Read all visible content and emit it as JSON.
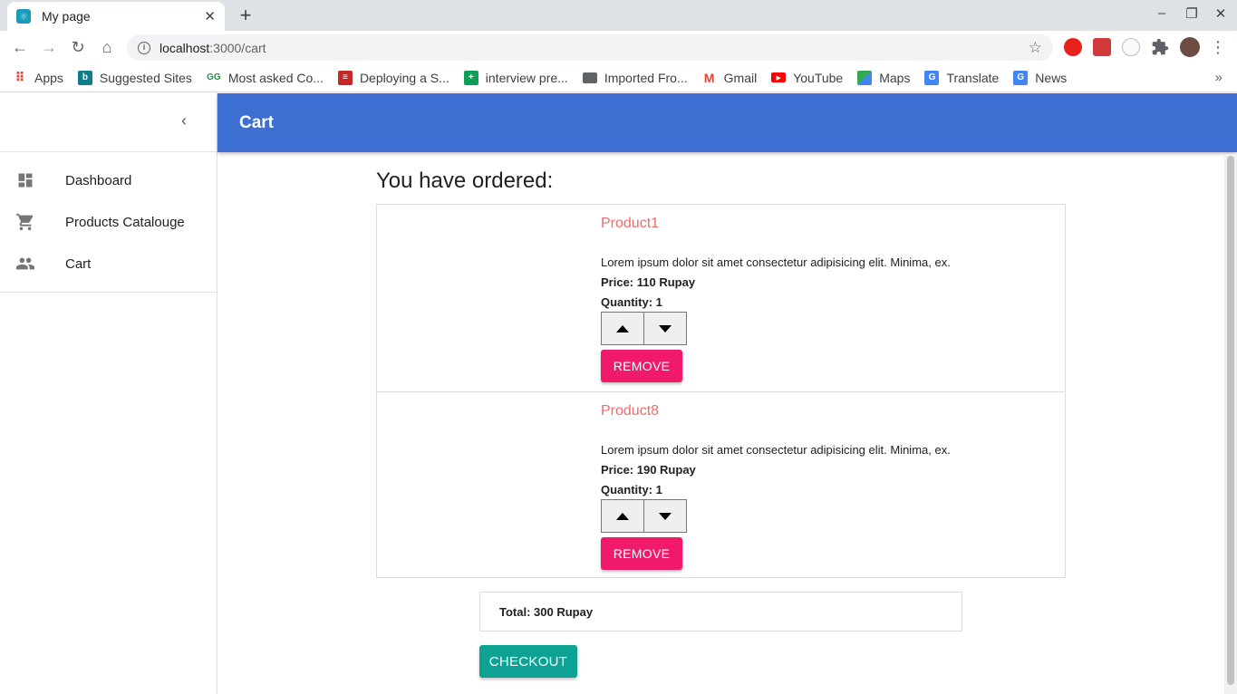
{
  "browser": {
    "tab_title": "My page",
    "url_host": "localhost",
    "url_path": ":3000/cart",
    "bookmarks": [
      {
        "label": "Apps",
        "icon": "apps-grid-icon",
        "color": "#ea4335"
      },
      {
        "label": "Suggested Sites",
        "icon": "bing-icon",
        "color": "#0f7c8c"
      },
      {
        "label": "Most asked Co...",
        "icon": "gfg-icon",
        "color": "#2f8d46"
      },
      {
        "label": "Deploying a S...",
        "icon": "article-icon",
        "color": "#c62828"
      },
      {
        "label": "interview pre...",
        "icon": "sheets-icon",
        "color": "#0f9d58"
      },
      {
        "label": "Imported Fro...",
        "icon": "folder-icon",
        "color": "#5f6368"
      },
      {
        "label": "Gmail",
        "icon": "gmail-icon",
        "color": "#ea4335"
      },
      {
        "label": "YouTube",
        "icon": "youtube-icon",
        "color": "#ff0000"
      },
      {
        "label": "Maps",
        "icon": "maps-icon",
        "color": "#34a853"
      },
      {
        "label": "Translate",
        "icon": "translate-icon",
        "color": "#4285f4"
      },
      {
        "label": "News",
        "icon": "news-icon",
        "color": "#4285f4"
      }
    ]
  },
  "drawer": {
    "items": [
      {
        "label": "Dashboard",
        "icon": "dashboard-icon"
      },
      {
        "label": "Products Catalouge",
        "icon": "cart-icon"
      },
      {
        "label": "Cart",
        "icon": "people-icon"
      }
    ]
  },
  "appbar": {
    "title": "Cart"
  },
  "cart": {
    "heading": "You have ordered:",
    "items": [
      {
        "name": "Product1",
        "description": "Lorem ipsum dolor sit amet consectetur adipisicing elit. Minima, ex.",
        "price": "Price: 110 Rupay",
        "quantity": "Quantity: 1",
        "remove_label": "REMOVE"
      },
      {
        "name": "Product8",
        "description": "Lorem ipsum dolor sit amet consectetur adipisicing elit. Minima, ex.",
        "price": "Price: 190 Rupay",
        "quantity": "Quantity: 1",
        "remove_label": "REMOVE"
      }
    ],
    "total": "Total: 300 Rupay",
    "checkout_label": "CHECKOUT"
  },
  "colors": {
    "appbar": "#3c6fd1",
    "product_name": "#ef6c6c",
    "remove_button": "#f0196a",
    "checkout_button": "#0ea294"
  }
}
